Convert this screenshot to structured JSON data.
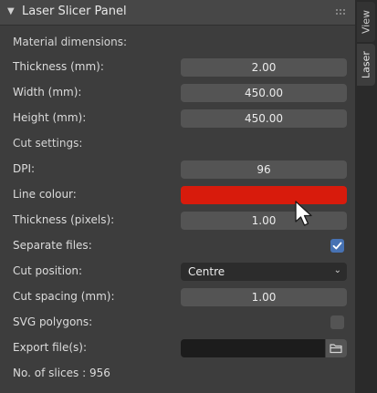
{
  "panel": {
    "title": "Laser Slicer Panel"
  },
  "tabs": [
    {
      "label": "View"
    },
    {
      "label": "Laser"
    }
  ],
  "sections": {
    "material": "Material dimensions:",
    "cut": "Cut settings:"
  },
  "fields": {
    "thickness_mm": {
      "label": "Thickness (mm):",
      "value": "2.00"
    },
    "width_mm": {
      "label": "Width (mm):",
      "value": "450.00"
    },
    "height_mm": {
      "label": "Height (mm):",
      "value": "450.00"
    },
    "dpi": {
      "label": "DPI:",
      "value": "96"
    },
    "line_colour": {
      "label": "Line colour:",
      "color": "#d81b0c"
    },
    "thickness_px": {
      "label": "Thickness (pixels):",
      "value": "1.00"
    },
    "separate_files": {
      "label": "Separate files:",
      "checked": true
    },
    "cut_position": {
      "label": "Cut position:",
      "value": "Centre"
    },
    "cut_spacing": {
      "label": "Cut spacing (mm):",
      "value": "1.00"
    },
    "svg_polygons": {
      "label": "SVG polygons:",
      "checked": false
    },
    "export_files": {
      "label": "Export file(s):",
      "value": ""
    }
  },
  "footer": {
    "slices": "No. of slices : 956"
  },
  "icons": {
    "collapse": "triangle-down-icon",
    "grip": "drag-grip-icon",
    "check": "checkmark-icon",
    "folder": "folder-icon",
    "dropdown": "chevron-down-icon",
    "cursor": "mouse-pointer-icon"
  }
}
